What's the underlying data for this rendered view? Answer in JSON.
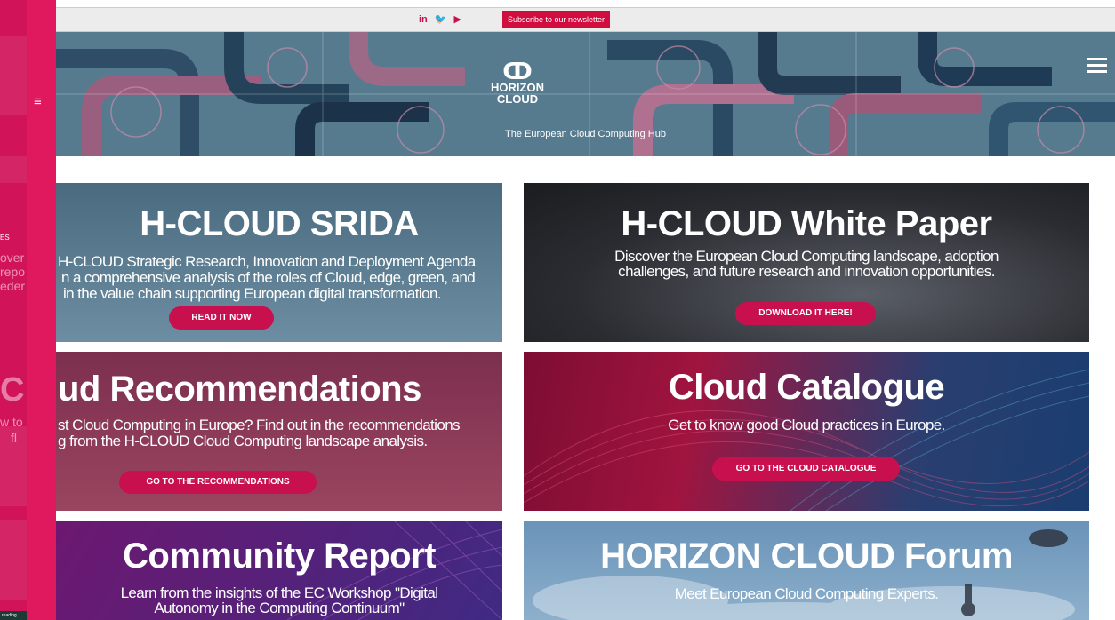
{
  "sidebar": {
    "menu_icon": "≡",
    "fragments": [
      "ES",
      "over",
      "repo",
      "eder",
      "C",
      "w to",
      "fl"
    ],
    "badge": "reading"
  },
  "topbar": {
    "social": [
      "in",
      "🐦",
      "▶"
    ],
    "social_icons": [
      "linkedin-icon",
      "twitter-icon",
      "youtube-icon"
    ],
    "subscribe_label": "Subscribe to our newsletter"
  },
  "hero": {
    "logo_icon": "ↀ",
    "logo_line1": "HORIZON",
    "logo_line2": "CLOUD",
    "tagline": "The European Cloud Computing Hub"
  },
  "cards": [
    {
      "title": "H-CLOUD SRIDA",
      "desc1": "H-CLOUD Strategic Research, Innovation and Deployment Agenda",
      "desc2": "n a comprehensive analysis of the roles of Cloud, edge, green, and",
      "desc3": "in the value chain supporting European digital transformation.",
      "button": "READ IT NOW"
    },
    {
      "title": "H-CLOUD White Paper",
      "desc1": "Discover the European Cloud Computing landscape, adoption",
      "desc2": "challenges, and future research and innovation opportunities.",
      "button": "DOWNLOAD IT HERE!"
    },
    {
      "title": "ud Recommendations",
      "desc1": "st Cloud Computing in Europe? Find out in the recommendations",
      "desc2": "g from the H-CLOUD Cloud Computing landscape analysis.",
      "button": "GO TO THE RECOMMENDATIONS"
    },
    {
      "title": "Cloud Catalogue",
      "desc1": "Get to know good Cloud practices in Europe.",
      "button": "GO TO THE CLOUD CATALOGUE"
    },
    {
      "title": "Community Report",
      "desc1": "Learn from the insights of the EC Workshop \"Digital",
      "desc2": "Autonomy in the Computing Continuum\""
    },
    {
      "title": "HORIZON CLOUD Forum",
      "desc1": "Meet European Cloud Computing Experts."
    }
  ],
  "colors": {
    "accent": "#e0185e",
    "button": "#c8104f",
    "subscribe": "#d10d3f"
  }
}
